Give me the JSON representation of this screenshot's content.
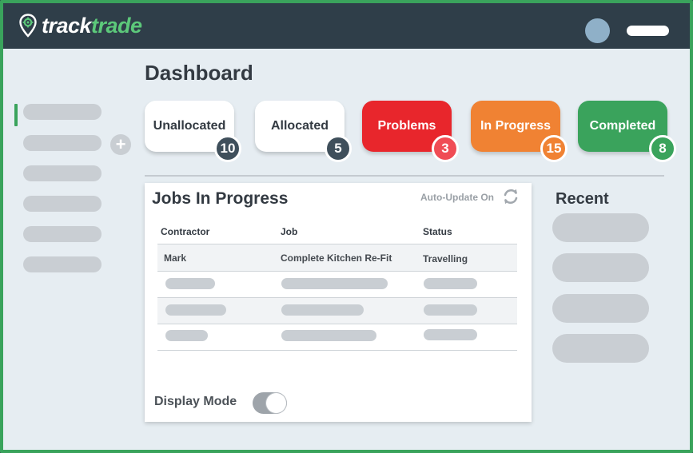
{
  "app": {
    "logo_part1": "track",
    "logo_part2": "trade",
    "brand_color": "#3aa35c"
  },
  "page": {
    "title": "Dashboard"
  },
  "status_cards": [
    {
      "label": "Unallocated",
      "count": "10",
      "bg": "#ffffff",
      "text_color": "#333a42",
      "badge_color": "#3f4f5b"
    },
    {
      "label": "Allocated",
      "count": "5",
      "bg": "#ffffff",
      "text_color": "#333a42",
      "badge_color": "#3f4f5b"
    },
    {
      "label": "Problems",
      "count": "3",
      "bg": "#e8262c",
      "text_color": "#ffffff",
      "badge_color": "#f04c55"
    },
    {
      "label": "In Progress",
      "count": "15",
      "bg": "#f08233",
      "text_color": "#ffffff",
      "badge_color": "#f08233"
    },
    {
      "label": "Completed",
      "count": "8",
      "bg": "#3aa35c",
      "text_color": "#ffffff",
      "badge_color": "#3aa35c"
    }
  ],
  "jobs": {
    "title": "Jobs In Progress",
    "auto_update": "Auto-Update On",
    "refresh_icon": "refresh-icon",
    "columns": [
      "Contractor",
      "Job",
      "Status"
    ],
    "rows": [
      {
        "contractor": "Mark",
        "job": "Complete Kitchen Re-Fit",
        "status": "Travelling"
      }
    ],
    "display_mode_label": "Display Mode",
    "display_mode_on": true
  },
  "recent": {
    "title": "Recent"
  },
  "icons": {
    "logo": "map-pin-gear-icon",
    "add": "plus-icon",
    "avatar": "user-avatar",
    "toggle": "toggle-switch"
  }
}
